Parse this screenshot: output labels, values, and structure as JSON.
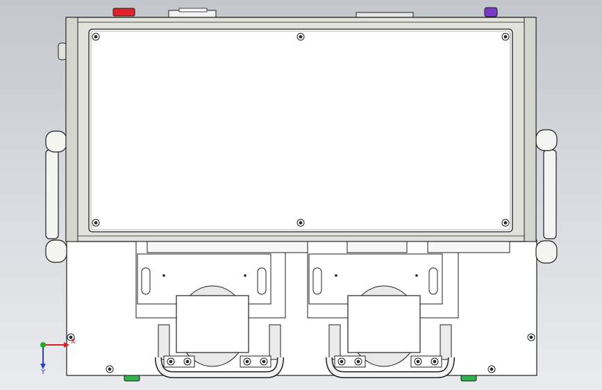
{
  "view": {
    "background_top": "#c3c7cc",
    "background_bottom": "#e9ebee"
  },
  "triad": {
    "x_label": "X",
    "y_label": "Y",
    "x_color": "#d42020",
    "y_color": "#2a3fc8",
    "z_color": "#1eaa2a"
  },
  "colors": {
    "panel_fill": "#ffffff",
    "line": "#1e1e1e",
    "frame_metal": "#e2e2dc",
    "emergency_stop": "#e2222a",
    "indicator_purple": "#7a3bc4",
    "foot_green": "#2fb24a",
    "handle_fill": "#f4f4f1",
    "tube_fill": "#ebebeb"
  },
  "icons": [
    "emergency-stop-icon",
    "purple-indicator-icon",
    "screw-icon",
    "foot-icon",
    "axis-triad-icon"
  ]
}
